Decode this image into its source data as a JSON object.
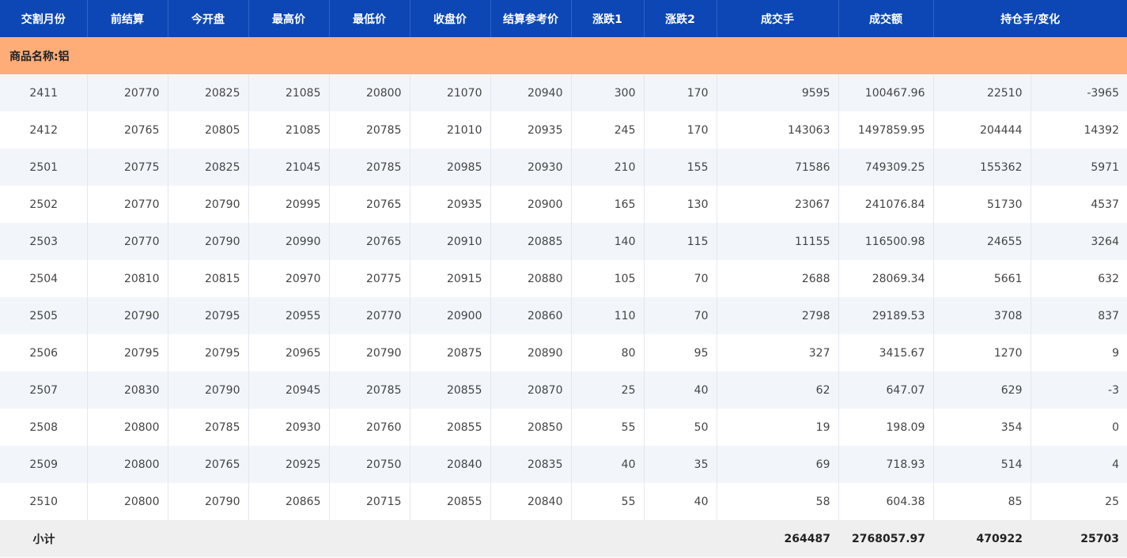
{
  "header": {
    "columns": [
      "交割月份",
      "前结算",
      "今开盘",
      "最高价",
      "最低价",
      "收盘价",
      "结算参考价",
      "涨跌1",
      "涨跌2",
      "成交手",
      "成交额",
      "持仓手/变化"
    ]
  },
  "group": {
    "label": "商品名称:铝"
  },
  "rows": [
    [
      "2411",
      "20770",
      "20825",
      "21085",
      "20800",
      "21070",
      "20940",
      "300",
      "170",
      "9595",
      "100467.96",
      "22510",
      "-3965"
    ],
    [
      "2412",
      "20765",
      "20805",
      "21085",
      "20785",
      "21010",
      "20935",
      "245",
      "170",
      "143063",
      "1497859.95",
      "204444",
      "14392"
    ],
    [
      "2501",
      "20775",
      "20825",
      "21045",
      "20785",
      "20985",
      "20930",
      "210",
      "155",
      "71586",
      "749309.25",
      "155362",
      "5971"
    ],
    [
      "2502",
      "20770",
      "20790",
      "20995",
      "20765",
      "20935",
      "20900",
      "165",
      "130",
      "23067",
      "241076.84",
      "51730",
      "4537"
    ],
    [
      "2503",
      "20770",
      "20790",
      "20990",
      "20765",
      "20910",
      "20885",
      "140",
      "115",
      "11155",
      "116500.98",
      "24655",
      "3264"
    ],
    [
      "2504",
      "20810",
      "20815",
      "20970",
      "20775",
      "20915",
      "20880",
      "105",
      "70",
      "2688",
      "28069.34",
      "5661",
      "632"
    ],
    [
      "2505",
      "20790",
      "20795",
      "20955",
      "20770",
      "20900",
      "20860",
      "110",
      "70",
      "2798",
      "29189.53",
      "3708",
      "837"
    ],
    [
      "2506",
      "20795",
      "20795",
      "20965",
      "20790",
      "20875",
      "20890",
      "80",
      "95",
      "327",
      "3415.67",
      "1270",
      "9"
    ],
    [
      "2507",
      "20830",
      "20790",
      "20945",
      "20785",
      "20855",
      "20870",
      "25",
      "40",
      "62",
      "647.07",
      "629",
      "-3"
    ],
    [
      "2508",
      "20800",
      "20785",
      "20930",
      "20760",
      "20855",
      "20850",
      "55",
      "50",
      "19",
      "198.09",
      "354",
      "0"
    ],
    [
      "2509",
      "20800",
      "20765",
      "20925",
      "20750",
      "20840",
      "20835",
      "40",
      "35",
      "69",
      "718.93",
      "514",
      "4"
    ],
    [
      "2510",
      "20800",
      "20790",
      "20865",
      "20715",
      "20855",
      "20840",
      "55",
      "40",
      "58",
      "604.38",
      "85",
      "25"
    ]
  ],
  "subtotal": {
    "label": "小计",
    "volume": "264487",
    "turnover": "2768057.97",
    "open_interest": "470922",
    "change": "25703"
  }
}
